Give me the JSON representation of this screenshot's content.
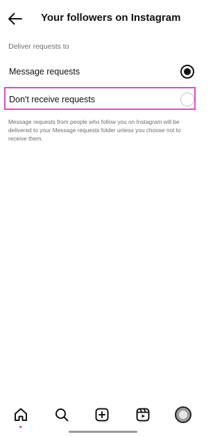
{
  "header": {
    "title": "Your followers on Instagram",
    "back_icon": "arrow-left-icon"
  },
  "settings": {
    "section_label": "Deliver requests to",
    "options": [
      {
        "label": "Message requests",
        "selected": true
      },
      {
        "label": "Don't receive requests",
        "selected": false
      }
    ],
    "help_text": "Message requests from people who follow you on Instagram will be delivered to your Message requests folder unless you choose not to receive them."
  },
  "highlight_color": "#e24ac2",
  "bottom_nav": {
    "items": [
      {
        "icon": "home-icon",
        "active": true
      },
      {
        "icon": "search-icon"
      },
      {
        "icon": "create-plus-icon"
      },
      {
        "icon": "reels-icon"
      },
      {
        "icon": "profile-avatar-icon"
      }
    ]
  }
}
